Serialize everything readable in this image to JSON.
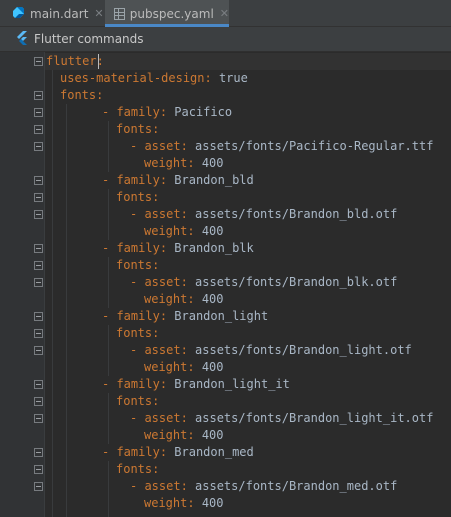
{
  "tabs": [
    {
      "label": "main.dart",
      "icon": "dart-file-icon",
      "active": false
    },
    {
      "label": "pubspec.yaml",
      "icon": "yaml-file-icon",
      "active": true
    }
  ],
  "toolbar": {
    "label": "Flutter commands",
    "icon": "flutter-icon"
  },
  "editor": {
    "lines": [
      {
        "indent": 0,
        "dash": false,
        "key": "flutter",
        "value": ""
      },
      {
        "indent": 1,
        "dash": false,
        "key": "uses-material-design",
        "value": "true"
      },
      {
        "indent": 1,
        "dash": false,
        "key": "fonts",
        "value": ""
      },
      {
        "indent": 2,
        "dash": true,
        "key": "family",
        "value": "Pacifico"
      },
      {
        "indent": 3,
        "dash": false,
        "key": "fonts",
        "value": ""
      },
      {
        "indent": 4,
        "dash": true,
        "key": "asset",
        "value": "assets/fonts/Pacifico-Regular.ttf"
      },
      {
        "indent": 5,
        "dash": false,
        "key": "weight",
        "value": "400"
      },
      {
        "indent": 2,
        "dash": true,
        "key": "family",
        "value": "Brandon_bld"
      },
      {
        "indent": 3,
        "dash": false,
        "key": "fonts",
        "value": ""
      },
      {
        "indent": 4,
        "dash": true,
        "key": "asset",
        "value": "assets/fonts/Brandon_bld.otf"
      },
      {
        "indent": 5,
        "dash": false,
        "key": "weight",
        "value": "400"
      },
      {
        "indent": 2,
        "dash": true,
        "key": "family",
        "value": "Brandon_blk"
      },
      {
        "indent": 3,
        "dash": false,
        "key": "fonts",
        "value": ""
      },
      {
        "indent": 4,
        "dash": true,
        "key": "asset",
        "value": "assets/fonts/Brandon_blk.otf"
      },
      {
        "indent": 5,
        "dash": false,
        "key": "weight",
        "value": "400"
      },
      {
        "indent": 2,
        "dash": true,
        "key": "family",
        "value": "Brandon_light"
      },
      {
        "indent": 3,
        "dash": false,
        "key": "fonts",
        "value": ""
      },
      {
        "indent": 4,
        "dash": true,
        "key": "asset",
        "value": "assets/fonts/Brandon_light.otf"
      },
      {
        "indent": 5,
        "dash": false,
        "key": "weight",
        "value": "400"
      },
      {
        "indent": 2,
        "dash": true,
        "key": "family",
        "value": "Brandon_light_it"
      },
      {
        "indent": 3,
        "dash": false,
        "key": "fonts",
        "value": ""
      },
      {
        "indent": 4,
        "dash": true,
        "key": "asset",
        "value": "assets/fonts/Brandon_light_it.otf"
      },
      {
        "indent": 5,
        "dash": false,
        "key": "weight",
        "value": "400"
      },
      {
        "indent": 2,
        "dash": true,
        "key": "family",
        "value": "Brandon_med"
      },
      {
        "indent": 3,
        "dash": false,
        "key": "fonts",
        "value": ""
      },
      {
        "indent": 4,
        "dash": true,
        "key": "asset",
        "value": "assets/fonts/Brandon_med.otf"
      },
      {
        "indent": 5,
        "dash": false,
        "key": "weight",
        "value": "400"
      }
    ]
  },
  "colors": {
    "editor_background": "#2b2b2b",
    "gutter_background": "#313335",
    "yaml_key": "#cc7832",
    "yaml_value": "#a9b7c6",
    "active_tab_underline": "#4a88c7"
  }
}
